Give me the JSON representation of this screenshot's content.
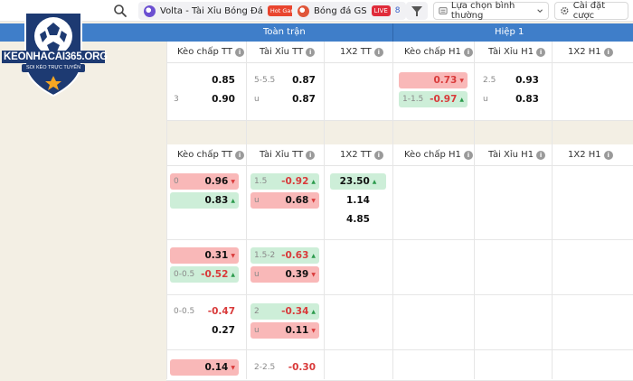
{
  "topbar": {
    "tab_volta": {
      "label": "Volta - Tài Xỉu Bóng Đá",
      "badge": "Hot Game"
    },
    "tab_gs": {
      "label": "Bóng đá GS",
      "badge": "LIVE",
      "count": "8"
    },
    "select_label": "Lựa chọn bình thường",
    "settings_label": "Cài đặt cược"
  },
  "logo": {
    "main": "KEONHACAI365.ORG",
    "sub": "SOI KÈO TRỰC TUYẾN"
  },
  "bands": {
    "full": "Toàn trận",
    "half": "Hiệp 1"
  },
  "columns": [
    "Kèo chấp TT",
    "Tài Xỉu TT",
    "1X2 TT",
    "Kèo chấp H1",
    "Tài Xỉu H1",
    "1X2 H1"
  ],
  "cells": {
    "r1": [
      {
        "hc": "",
        "val": "0.85"
      },
      {
        "hc": "3",
        "val": "0.90"
      },
      {
        "hc": "5-5.5",
        "val": "0.87"
      },
      {
        "hc": "u",
        "val": "0.87"
      },
      {
        "hc": "",
        "val": "0.73"
      },
      {
        "hc": "1-1.5",
        "val": "-0.97"
      },
      {
        "hc": "2.5",
        "val": "0.93"
      },
      {
        "hc": "u",
        "val": "0.83"
      }
    ],
    "r2": [
      {
        "hc": "0",
        "val": "0.96"
      },
      {
        "hc": "",
        "val": "0.83"
      },
      {
        "hc": "1.5",
        "val": "-0.92"
      },
      {
        "hc": "u",
        "val": "0.68"
      },
      {
        "hc": "",
        "val": "23.50"
      },
      {
        "hc": "",
        "val": "1.14"
      },
      {
        "hc": "",
        "val": "4.85"
      }
    ],
    "r3": [
      {
        "hc": "",
        "val": "0.31"
      },
      {
        "hc": "0-0.5",
        "val": "-0.52"
      },
      {
        "hc": "1.5-2",
        "val": "-0.63"
      },
      {
        "hc": "u",
        "val": "0.39"
      }
    ],
    "r4": [
      {
        "hc": "0-0.5",
        "val": "-0.47"
      },
      {
        "hc": "",
        "val": "0.27"
      },
      {
        "hc": "2",
        "val": "-0.34"
      },
      {
        "hc": "u",
        "val": "0.11"
      }
    ],
    "r5": [
      {
        "hc": "",
        "val": "0.14"
      },
      {
        "hc": "2-2.5",
        "val": "-0.30"
      }
    ]
  }
}
